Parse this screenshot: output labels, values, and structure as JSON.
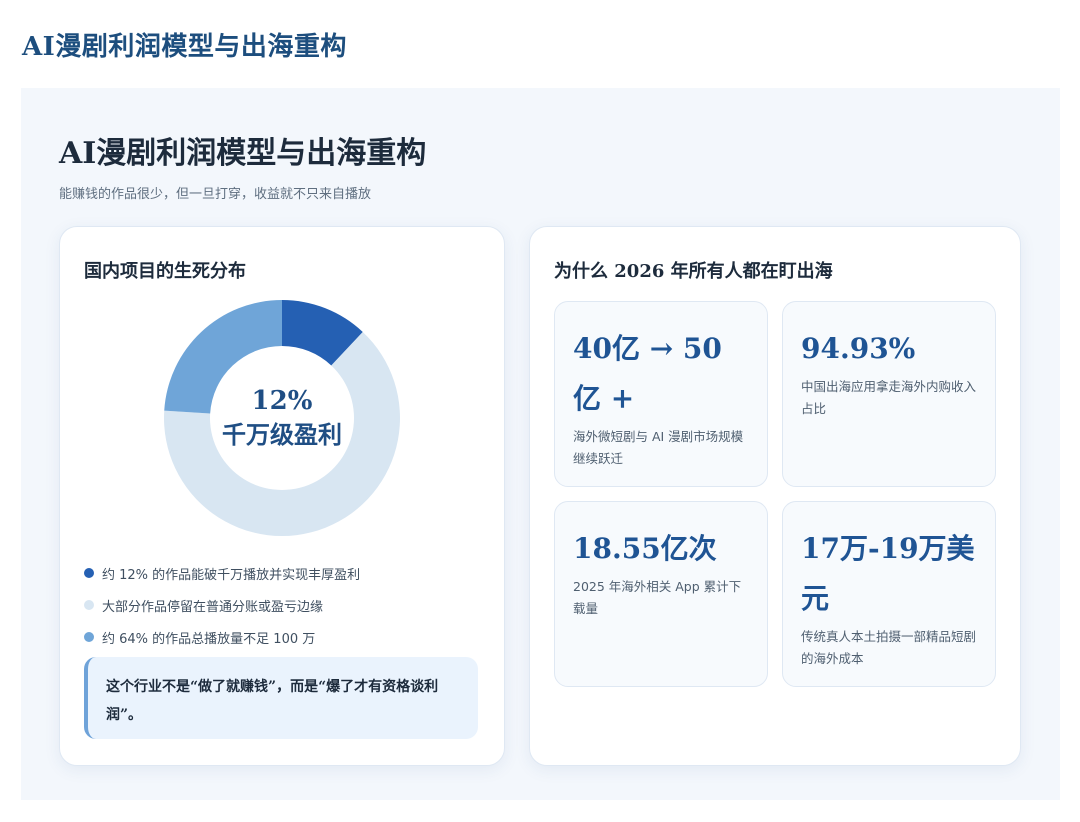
{
  "page": {
    "title": "AI漫剧利润模型与出海重构"
  },
  "slide": {
    "title": "AI漫剧利润模型与出海重构",
    "subtitle": "能赚钱的作品很少，但一旦打穿，收益就不只来自播放"
  },
  "left_card": {
    "title": "国内项目的生死分布",
    "donut": {
      "center_value": "12%",
      "center_label": "千万级盈利"
    },
    "legend": [
      {
        "label": "约 12% 的作品能破千万播放并实现丰厚盈利",
        "color": "#2560b3"
      },
      {
        "label": "大部分作品停留在普通分账或盈亏边缘",
        "color": "#d8e6f2"
      },
      {
        "label": "约 64% 的作品总播放量不足 100 万",
        "color": "#6fa5d8"
      }
    ],
    "callout": "这个行业不是“做了就赚钱”，而是“爆了才有资格谈利润”。"
  },
  "right_card": {
    "title": "为什么 2026 年所有人都在盯出海",
    "stats": [
      {
        "value": "40亿 → 50亿 +",
        "desc": "海外微短剧与 AI 漫剧市场规模继续跃迁"
      },
      {
        "value": "94.93%",
        "desc": "中国出海应用拿走海外内购收入占比"
      },
      {
        "value": "18.55亿次",
        "desc": "2025 年海外相关 App 累计下载量"
      },
      {
        "value": "17万-19万美元",
        "desc": "传统真人本土拍摄一部精品短剧的海外成本"
      }
    ]
  },
  "chart_data": {
    "type": "pie",
    "categories": [
      "约 12% 的作品能破千万播放并实现丰厚盈利",
      "大部分作品停留在普通分账或盈亏边缘",
      "约 64% 的作品总播放量不足 100 万"
    ],
    "values": [
      12,
      64,
      24
    ],
    "colors": [
      "#2560b3",
      "#d8e6f2",
      "#6fa5d8"
    ]
  }
}
